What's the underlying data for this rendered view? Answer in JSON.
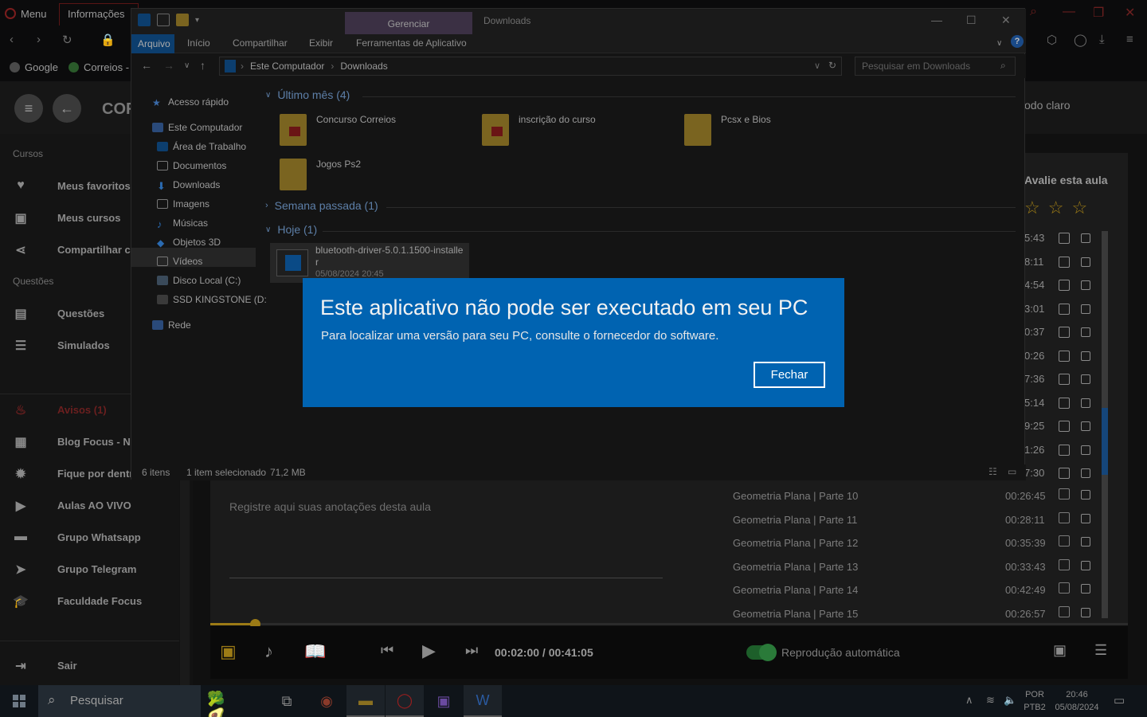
{
  "browser": {
    "menu_label": "Menu",
    "active_tab_label": "Informações",
    "bookmarks": [
      "Google",
      "Correios - ..."
    ],
    "app_title": "COR",
    "theme_toggle": "odo claro"
  },
  "sidebar": {
    "section_cursos": "Cursos",
    "section_questoes": "Questões",
    "items_cursos": [
      "Meus favoritos",
      "Meus cursos",
      "Compartilhar cu"
    ],
    "items_questoes": [
      "Questões",
      "Simulados"
    ],
    "items_misc": [
      "Avisos (1)",
      "Blog Focus - No",
      "Fique por dentro",
      "Aulas AO VIVO",
      "Grupo Whatsapp",
      "Grupo Telegram",
      "Faculdade Focus"
    ],
    "logout": "Sair"
  },
  "course": {
    "rate_label": "Avalie esta aula",
    "hidden_times": [
      "5:43",
      "8:11",
      "4:54",
      "3:01",
      "0:37",
      "0:26",
      "7:36",
      "5:14",
      "9:25",
      "1:26",
      "7:30"
    ],
    "lessons": [
      {
        "title": "Geometria Plana | Parte 10",
        "duration": "00:26:45"
      },
      {
        "title": "Geometria Plana | Parte 11",
        "duration": "00:28:11"
      },
      {
        "title": "Geometria Plana | Parte 12",
        "duration": "00:35:39"
      },
      {
        "title": "Geometria Plana | Parte 13",
        "duration": "00:33:43"
      },
      {
        "title": "Geometria Plana | Parte 14",
        "duration": "00:42:49"
      },
      {
        "title": "Geometria Plana | Parte 15",
        "duration": "00:26:57"
      }
    ],
    "notes_placeholder": "Registre aqui suas anotações desta aula",
    "progress_fraction": 0.049
  },
  "player": {
    "time": "00:02:00 / 00:41:05",
    "autoplay_label": "Reprodução automática"
  },
  "explorer": {
    "window_title": "Downloads",
    "manage_tab": "Gerenciar",
    "ribbon_tabs": [
      "Arquivo",
      "Início",
      "Compartilhar",
      "Exibir",
      "Ferramentas de Aplicativo"
    ],
    "breadcrumb": [
      "Este Computador",
      "Downloads"
    ],
    "search_placeholder": "Pesquisar em Downloads",
    "tree": [
      "Acesso rápido",
      "Este Computador",
      "Área de Trabalho",
      "Documentos",
      "Downloads",
      "Imagens",
      "Músicas",
      "Objetos 3D",
      "Vídeos",
      "Disco Local (C:)",
      "SSD KINGSTONE (D:",
      "Rede"
    ],
    "groups": {
      "last_month": "Último mês (4)",
      "last_week": "Semana passada (1)",
      "today": "Hoje (1)"
    },
    "folders": [
      "Concurso Correios",
      "inscrição do curso",
      "Pcsx e Bios",
      "Jogos Ps2"
    ],
    "file": {
      "name": "bluetooth-driver-5.0.1.1500-installer",
      "date": "05/08/2024 20:45"
    },
    "status_items": "6 itens",
    "status_selected": "1 item selecionado",
    "status_size": "71,2 MB"
  },
  "dialog": {
    "title": "Este aplicativo não pode ser executado em seu PC",
    "message": "Para localizar uma versão para seu PC, consulte o fornecedor do software.",
    "button": "Fechar"
  },
  "taskbar": {
    "search_placeholder": "Pesquisar",
    "lang1": "POR",
    "lang2": "PTB2",
    "time": "20:46",
    "date": "05/08/2024"
  },
  "colors": {
    "dialog_bg": "#0063b1",
    "accent_gold": "#9c7b16"
  }
}
